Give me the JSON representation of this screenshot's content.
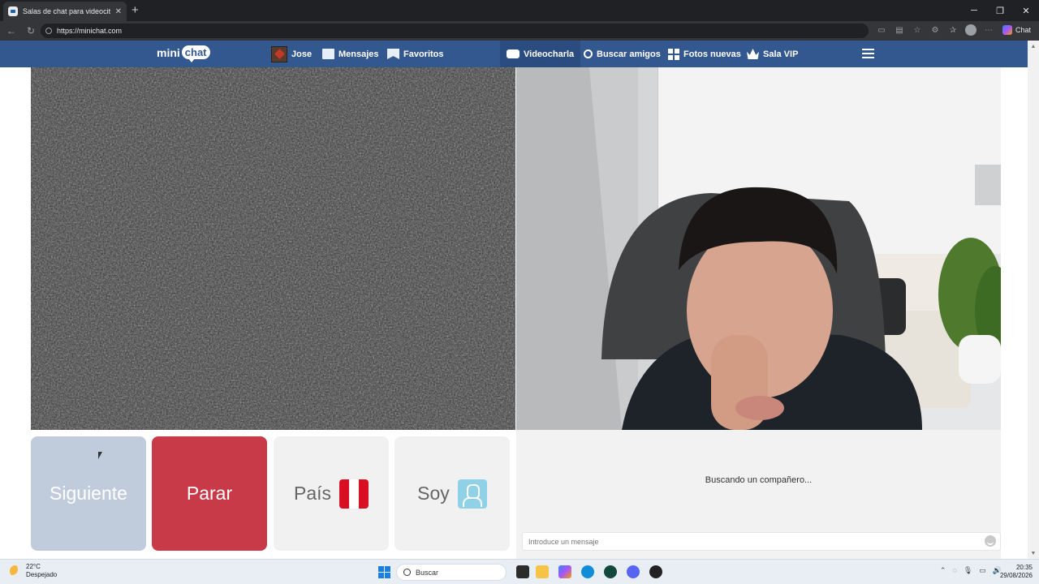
{
  "browser": {
    "tab_title": "Salas de chat para videocitas ...",
    "url": "https://minichat.com",
    "copilot_label": "Chat"
  },
  "nav": {
    "logo_mini": "mini",
    "logo_chat": "chat",
    "user_name": "Jose",
    "messages": "Mensajes",
    "favorites": "Favoritos",
    "videochat": "Videocharla",
    "find_friends": "Buscar amigos",
    "new_photos": "Fotos nuevas",
    "vip": "Sala VIP"
  },
  "controls": {
    "next": "Siguiente",
    "stop": "Parar",
    "country": "País",
    "gender": "Soy"
  },
  "chat": {
    "status": "Buscando un compañero...",
    "input_placeholder": "Introduce un mensaje"
  },
  "taskbar": {
    "temperature": "22°C",
    "weather": "Despejado",
    "search_placeholder": "Buscar",
    "time": "20:35",
    "date": "29/08/2026"
  },
  "colors": {
    "nav_bg": "#33588f",
    "stop_button": "#c93a48",
    "next_button": "#c0cbdc"
  }
}
